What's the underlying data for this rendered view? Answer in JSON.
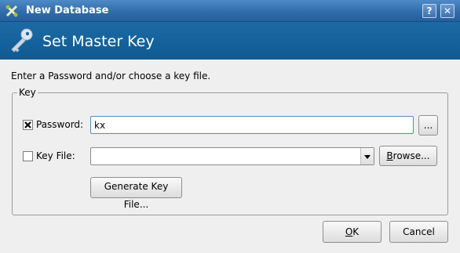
{
  "window": {
    "title": "New Database",
    "help_label": "?",
    "close_label": "✕"
  },
  "banner": {
    "title": "Set Master Key"
  },
  "instruction": "Enter a Password and/or choose a key file.",
  "group": {
    "label": "Key"
  },
  "password": {
    "label": "Password:",
    "checked": true,
    "value": "kx",
    "more_label": "..."
  },
  "keyfile": {
    "label": "Key File:",
    "checked": false,
    "value": "",
    "browse_label_underlined": "B",
    "browse_label_rest": "rowse..."
  },
  "generate": {
    "label": "Generate Key File..."
  },
  "buttons": {
    "ok_underlined": "O",
    "ok_rest": "K",
    "cancel": "Cancel"
  },
  "colors": {
    "title_bar": "#2f6aa9",
    "banner": "#1366a0"
  }
}
